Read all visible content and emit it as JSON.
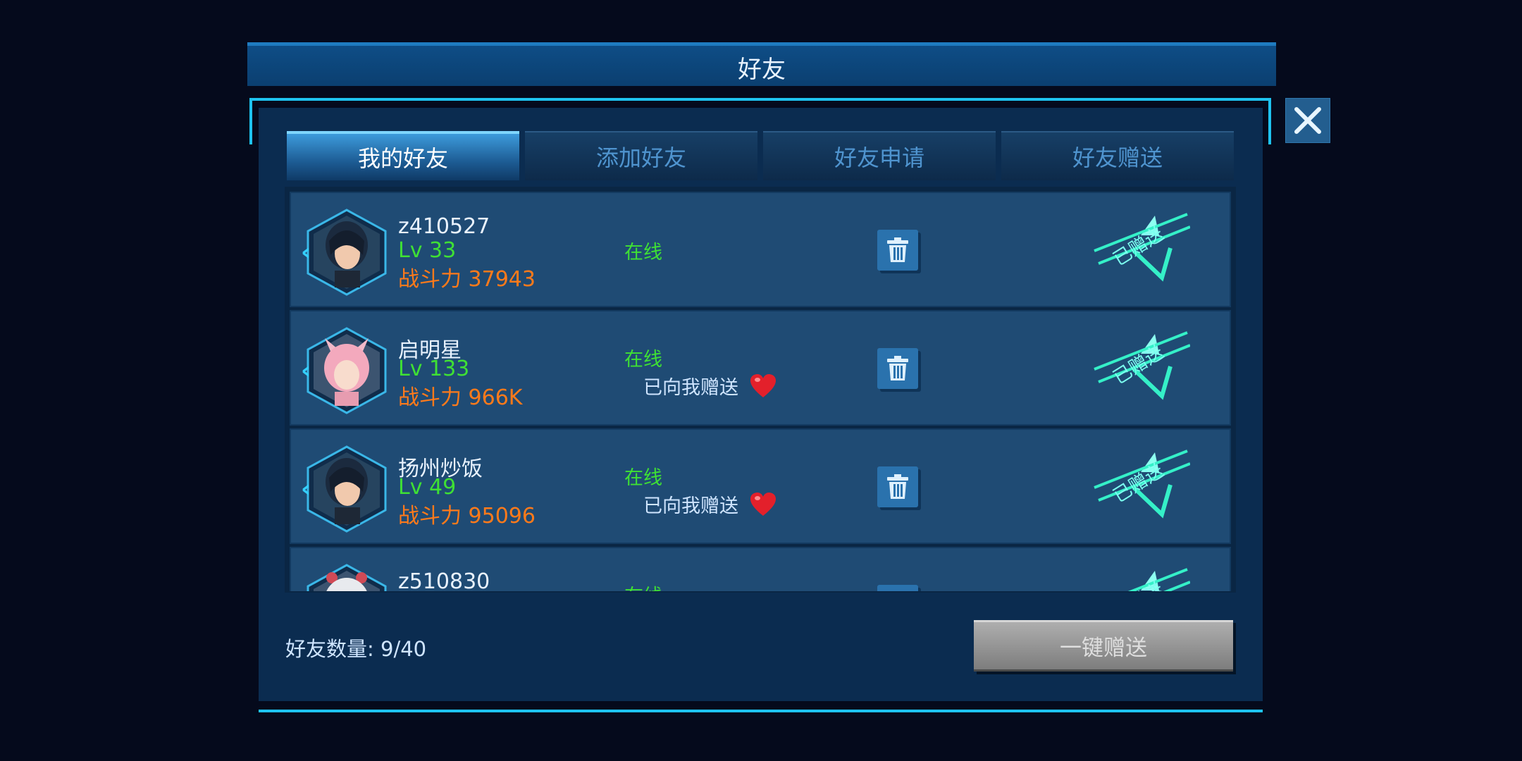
{
  "title": "好友",
  "tabs": [
    {
      "label": "我的好友",
      "active": true
    },
    {
      "label": "添加好友",
      "active": false
    },
    {
      "label": "好友申请",
      "active": false
    },
    {
      "label": "好友赠送",
      "active": false
    }
  ],
  "friends": [
    {
      "name": "z410527",
      "level": "Lv 33",
      "power": "战斗力 37943",
      "status": "在线",
      "gift_received": "",
      "gift_stamp": "已赠送",
      "avatar": "dark-hair-girl"
    },
    {
      "name": "启明星",
      "level": "Lv 133",
      "power": "战斗力 966K",
      "status": "在线",
      "gift_received": "已向我赠送",
      "gift_stamp": "已赠送",
      "avatar": "pink-hair-fox-girl"
    },
    {
      "name": "扬州炒饭",
      "level": "Lv 49",
      "power": "战斗力 95096",
      "status": "在线",
      "gift_received": "已向我赠送",
      "gift_stamp": "已赠送",
      "avatar": "dark-hair-girl"
    },
    {
      "name": "z510830",
      "level": "",
      "power": "",
      "status": "在线",
      "gift_received": "",
      "gift_stamp": "已赠送",
      "avatar": "white-hair-girl"
    }
  ],
  "footer": {
    "count_label": "好友数量: 9/40",
    "one_key_button": "一键赠送"
  },
  "colors": {
    "accent": "#1ec3f0",
    "online": "#3fe034",
    "power": "#ff7a1a",
    "stamp": "#35f0c8"
  }
}
